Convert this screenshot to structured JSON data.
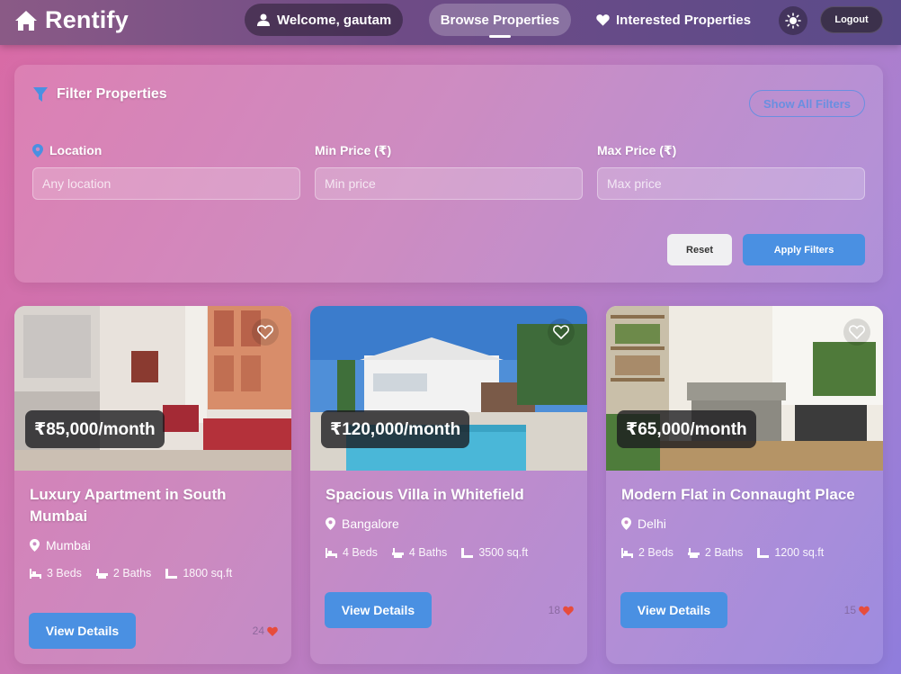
{
  "nav": {
    "brand": "Rentify",
    "welcome": "Welcome, gautam",
    "browse": "Browse Properties",
    "interested": "Interested Properties",
    "logout": "Logout"
  },
  "filter": {
    "title": "Filter Properties",
    "show_all": "Show All Filters",
    "location_label": "Location",
    "location_placeholder": "Any location",
    "min_label": "Min Price (₹)",
    "min_placeholder": "Min price",
    "max_label": "Max Price (₹)",
    "max_placeholder": "Max price",
    "reset": "Reset",
    "apply": "Apply Filters"
  },
  "properties": [
    {
      "price": "₹85,000/month",
      "title": "Luxury Apartment in South Mumbai",
      "location": "Mumbai",
      "beds": "3 Beds",
      "baths": "2 Baths",
      "area": "1800 sq.ft",
      "likes": "24",
      "button": "View Details"
    },
    {
      "price": "₹120,000/month",
      "title": "Spacious Villa in Whitefield",
      "location": "Bangalore",
      "beds": "4 Beds",
      "baths": "4 Baths",
      "area": "3500 sq.ft",
      "likes": "18",
      "button": "View Details"
    },
    {
      "price": "₹65,000/month",
      "title": "Modern Flat in Connaught Place",
      "location": "Delhi",
      "beds": "2 Beds",
      "baths": "2 Baths",
      "area": "1200 sq.ft",
      "likes": "15",
      "button": "View Details"
    }
  ],
  "colors": {
    "accent": "#4a90e2",
    "heart": "#e74c3c"
  },
  "icons": [
    "home-icon",
    "user-icon",
    "heart-icon",
    "sun-icon",
    "filter-icon",
    "map-marker-icon",
    "bed-icon",
    "bath-icon",
    "ruler-icon"
  ]
}
